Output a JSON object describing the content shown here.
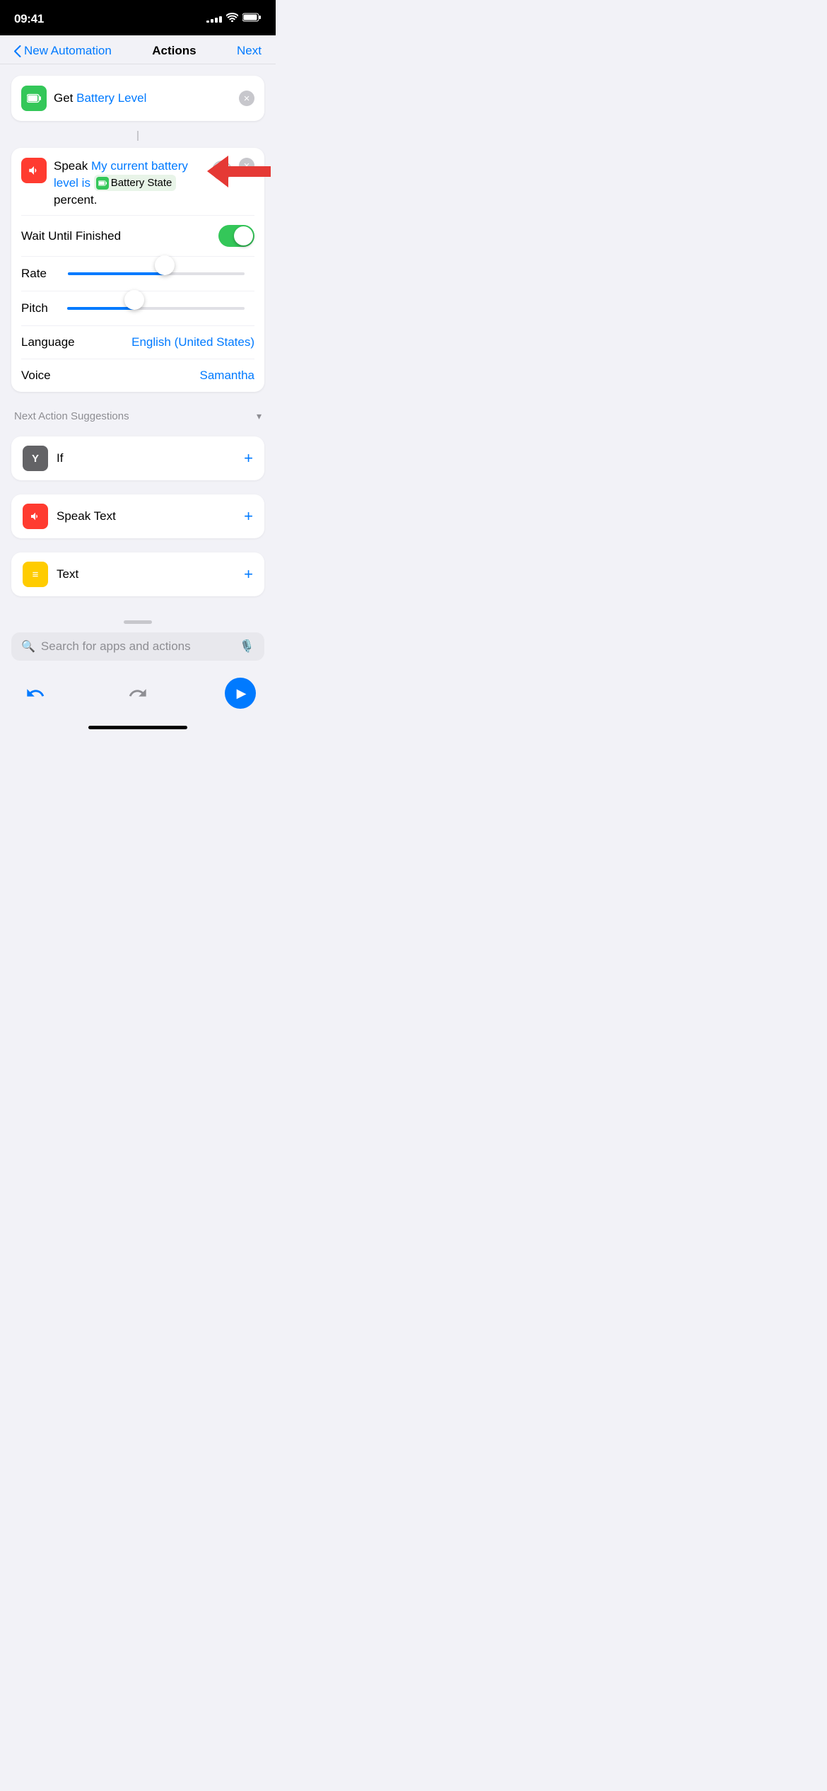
{
  "statusBar": {
    "time": "09:41",
    "signalBars": [
      3,
      5,
      7,
      9,
      11
    ],
    "battery": "full"
  },
  "nav": {
    "backLabel": "New Automation",
    "title": "Actions",
    "nextLabel": "Next"
  },
  "getCard": {
    "iconType": "green",
    "iconEmoji": "🔋",
    "prefixText": "Get",
    "variableText": "Battery Level"
  },
  "speakCard": {
    "iconType": "red",
    "iconEmoji": "🔊",
    "prefixText": "Speak",
    "contentText": "My current battery level is",
    "variableText": "Battery State",
    "variableSuffix": "percent.",
    "waitUntilFinished": true,
    "ratePercent": 55,
    "pitchPercent": 40,
    "language": "English (United States)",
    "voice": "Samantha",
    "waitLabel": "Wait Until Finished",
    "rateLabel": "Rate",
    "pitchLabel": "Pitch",
    "languageLabel": "Language",
    "voiceLabel": "Voice"
  },
  "suggestions": {
    "headerLabel": "Next Action Suggestions",
    "chevronLabel": "▾",
    "items": [
      {
        "iconType": "gray",
        "iconText": "Y",
        "label": "If"
      },
      {
        "iconType": "red",
        "iconEmoji": "🔊",
        "label": "Speak Text"
      },
      {
        "iconType": "yellow",
        "iconText": "≡",
        "label": "Text"
      }
    ]
  },
  "searchBar": {
    "placeholder": "Search for apps and actions"
  },
  "bottomBar": {
    "undoLabel": "↺",
    "redoLabel": "↻",
    "playLabel": "▶"
  }
}
